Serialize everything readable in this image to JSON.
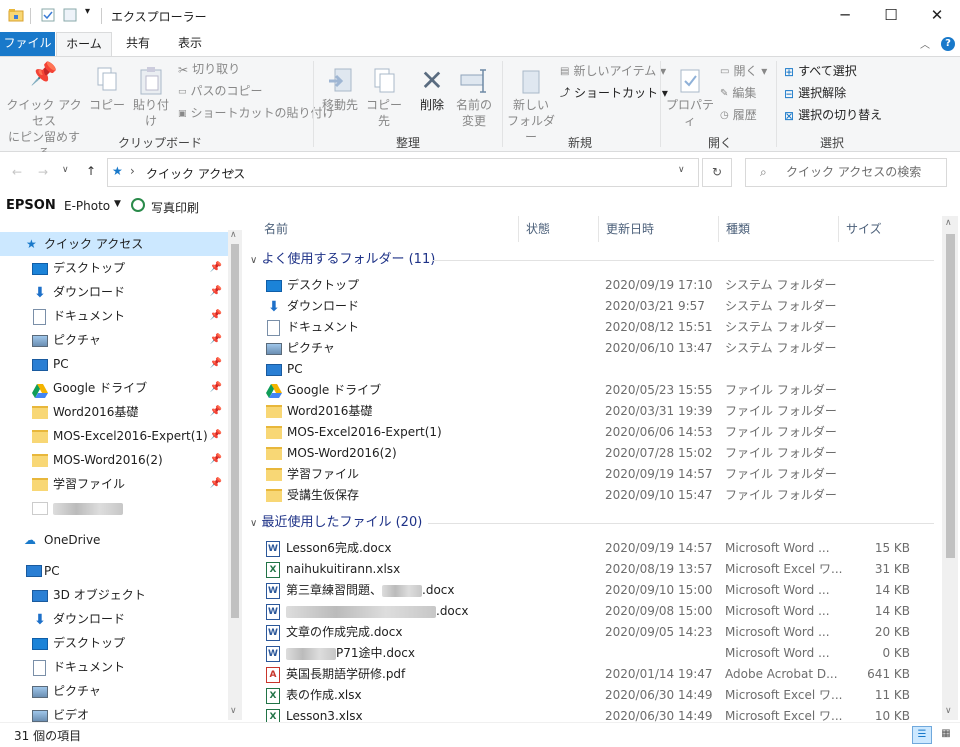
{
  "window": {
    "title": "エクスプローラー"
  },
  "ribbon_tabs": [
    {
      "label": "ファイル"
    },
    {
      "label": "ホーム"
    },
    {
      "label": "共有"
    },
    {
      "label": "表示"
    }
  ],
  "ribbon": {
    "pin_label_1": "クイック アクセス",
    "pin_label_2": "にピン留めする",
    "copy": "コピー",
    "paste": "貼り付け",
    "cut": "切り取り",
    "copy_path": "パスのコピー",
    "paste_shortcut": "ショートカットの貼り付け",
    "group_clipboard": "クリップボード",
    "move_to": "移動先",
    "copy_to": "コピー先",
    "delete": "削除",
    "rename_1": "名前の",
    "rename_2": "変更",
    "group_organize": "整理",
    "new_folder_1": "新しい",
    "new_folder_2": "フォルダー",
    "new_item": "新しいアイテム",
    "shortcut": "ショートカット",
    "group_new": "新規",
    "properties": "プロパティ",
    "open": "開く",
    "edit": "編集",
    "history": "履歴",
    "group_open": "開く",
    "select_all": "すべて選択",
    "select_none": "選択解除",
    "invert_selection": "選択の切り替え",
    "group_select": "選択"
  },
  "address": {
    "path": "クイック アクセス",
    "search_placeholder": "クイック アクセスの検索"
  },
  "epson_bar": {
    "brand": "EPSON",
    "app": "E-Photo",
    "print": "写真印刷"
  },
  "nav": {
    "quick_access": "クイック アクセス",
    "pinned": [
      {
        "label": "デスクトップ",
        "icon": "desktop-icon"
      },
      {
        "label": "ダウンロード",
        "icon": "download-icon"
      },
      {
        "label": "ドキュメント",
        "icon": "document-icon"
      },
      {
        "label": "ピクチャ",
        "icon": "picture-icon"
      },
      {
        "label": "PC",
        "icon": "pc-icon"
      },
      {
        "label": "Google ドライブ",
        "icon": "google-drive-icon"
      },
      {
        "label": "Word2016基礎",
        "icon": "folder-icon"
      },
      {
        "label": "MOS-Excel2016-Expert(1)",
        "icon": "folder-icon"
      },
      {
        "label": "MOS-Word2016(2)",
        "icon": "folder-icon"
      },
      {
        "label": "学習ファイル",
        "icon": "folder-icon"
      }
    ],
    "onedrive": "OneDrive",
    "pc": "PC",
    "pc_items": [
      {
        "label": "3D オブジェクト"
      },
      {
        "label": "ダウンロード"
      },
      {
        "label": "デスクトップ"
      },
      {
        "label": "ドキュメント"
      },
      {
        "label": "ピクチャ"
      },
      {
        "label": "ビデオ"
      }
    ]
  },
  "columns": {
    "name": "名前",
    "status": "状態",
    "date": "更新日時",
    "type": "種類",
    "size": "サイズ"
  },
  "groups": {
    "frequent": "よく使用するフォルダー (11)",
    "recent": "最近使用したファイル (20)"
  },
  "frequent_folders": [
    {
      "name": "デスクトップ",
      "date": "2020/09/19 17:10",
      "type": "システム フォルダー"
    },
    {
      "name": "ダウンロード",
      "date": "2020/03/21 9:57",
      "type": "システム フォルダー"
    },
    {
      "name": "ドキュメント",
      "date": "2020/08/12 15:51",
      "type": "システム フォルダー"
    },
    {
      "name": "ピクチャ",
      "date": "2020/06/10 13:47",
      "type": "システム フォルダー"
    },
    {
      "name": "PC",
      "date": "",
      "type": ""
    },
    {
      "name": "Google ドライブ",
      "date": "2020/05/23 15:55",
      "type": "ファイル フォルダー"
    },
    {
      "name": "Word2016基礎",
      "date": "2020/03/31 19:39",
      "type": "ファイル フォルダー"
    },
    {
      "name": "MOS-Excel2016-Expert(1)",
      "date": "2020/06/06 14:53",
      "type": "ファイル フォルダー"
    },
    {
      "name": "MOS-Word2016(2)",
      "date": "2020/07/28 15:02",
      "type": "ファイル フォルダー"
    },
    {
      "name": "学習ファイル",
      "date": "2020/09/19 14:57",
      "type": "ファイル フォルダー"
    },
    {
      "name": "受講生仮保存",
      "date": "2020/09/10 15:47",
      "type": "ファイル フォルダー"
    }
  ],
  "recent_files": [
    {
      "name": "Lesson6完成.docx",
      "date": "2020/09/19 14:57",
      "type": "Microsoft Word ...",
      "size": "15 KB"
    },
    {
      "name": "naihukuitirann.xlsx",
      "date": "2020/08/19 13:57",
      "type": "Microsoft Excel ワ...",
      "size": "31 KB"
    },
    {
      "name": "第三章練習問題、",
      "name2": ".docx",
      "date": "2020/09/10 15:00",
      "type": "Microsoft Word ...",
      "size": "14 KB"
    },
    {
      "name": "",
      "name2": ".docx",
      "date": "2020/09/08 15:00",
      "type": "Microsoft Word ...",
      "size": "14 KB"
    },
    {
      "name": "文章の作成完成.docx",
      "date": "2020/09/05 14:23",
      "type": "Microsoft Word ...",
      "size": "20 KB"
    },
    {
      "name": "",
      "name2": "P71途中.docx",
      "date": "",
      "type": "Microsoft Word ...",
      "size": "0 KB"
    },
    {
      "name": "英国長期語学研修.pdf",
      "date": "2020/01/14 19:47",
      "type": "Adobe Acrobat D...",
      "size": "641 KB"
    },
    {
      "name": "表の作成.xlsx",
      "date": "2020/06/30 14:49",
      "type": "Microsoft Excel ワ...",
      "size": "11 KB"
    },
    {
      "name": "Lesson3.xlsx",
      "date": "2020/06/30 14:49",
      "type": "Microsoft Excel ワ...",
      "size": "10 KB"
    }
  ],
  "status": {
    "count": "31 個の項目"
  }
}
